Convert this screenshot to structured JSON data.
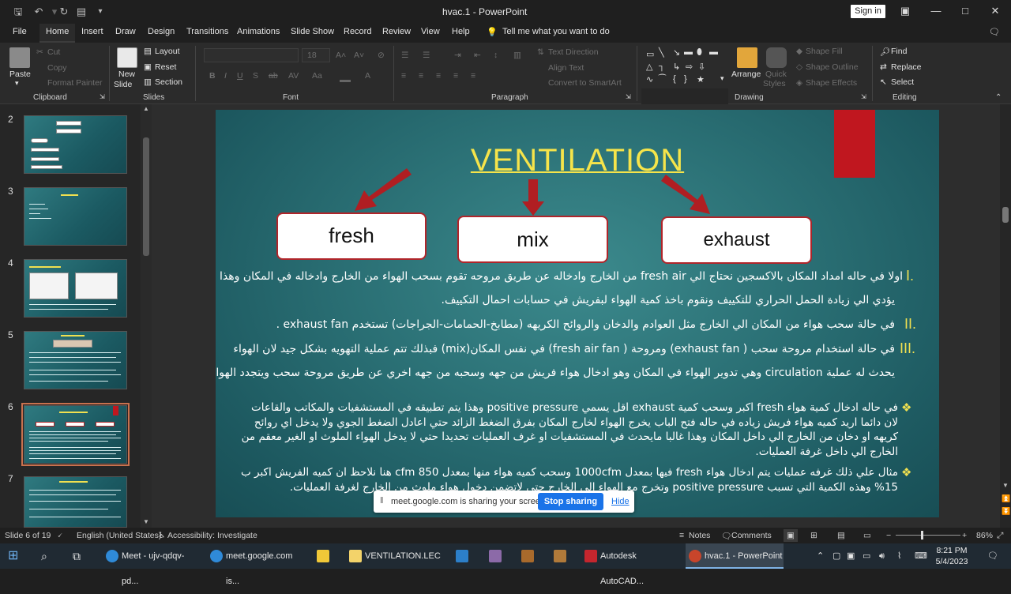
{
  "window": {
    "title": "hvac.1 - PowerPoint",
    "sign_in": "Sign in"
  },
  "tabs": [
    "File",
    "Home",
    "Insert",
    "Draw",
    "Design",
    "Transitions",
    "Animations",
    "Slide Show",
    "Record",
    "Review",
    "View",
    "Help"
  ],
  "active_tab": "Home",
  "tell_me": "Tell me what you want to do",
  "ribbon": {
    "clipboard": {
      "paste": "Paste",
      "cut": "Cut",
      "copy": "Copy",
      "format_painter": "Format Painter",
      "label": "Clipboard"
    },
    "slides": {
      "new_slide_1": "New",
      "new_slide_2": "Slide",
      "layout": "Layout",
      "reset": "Reset",
      "section": "Section",
      "label": "Slides"
    },
    "font": {
      "label": "Font",
      "size": "18"
    },
    "paragraph": {
      "text_direction": "Text Direction",
      "align_text": "Align Text",
      "smartart": "Convert to SmartArt",
      "label": "Paragraph"
    },
    "drawing": {
      "arrange": "Arrange",
      "quick_styles_1": "Quick",
      "quick_styles_2": "Styles",
      "shape_fill": "Shape Fill",
      "shape_outline": "Shape Outline",
      "shape_effects": "Shape Effects",
      "label": "Drawing"
    },
    "editing": {
      "find": "Find",
      "replace": "Replace",
      "select": "Select",
      "label": "Editing"
    }
  },
  "thumbnails": [
    {
      "num": "2",
      "title": "LECTURE (1)",
      "sub": "HVAC"
    },
    {
      "num": "3",
      "title": "HVAC"
    },
    {
      "num": "4",
      "title": "1-Heating process"
    },
    {
      "num": "5",
      "title": "VENTILATION"
    },
    {
      "num": "6",
      "title": "VENTILATION"
    },
    {
      "num": "7",
      "title": "VENTILATION"
    }
  ],
  "slide": {
    "title": "VENTILATION",
    "boxes": [
      "fresh",
      "mix",
      "exhaust"
    ],
    "markers": [
      "I.",
      "II.",
      "III."
    ],
    "line1": "اولا في حاله امداد المكان بالاكسجين نحتاج الي fresh air من الخارج وادخاله عن طريق مروحه تقوم بسحب الهواء من الخارج وادخاله في المكان وهذا",
    "line2": "يؤدي الي زيادة الحمل الحراري للتكييف ونقوم باخذ كمية الهواء لبفريش في حسابات احمال التكييف.",
    "line3": "في حالة سحب هواء من المكان الي الخارج مثل العوادم والدخان والروائح الكريهه (مطابخ-الحمامات-الجراجات) تستخدم exhaust fan .",
    "line4": "في حالة استخدام مروحة سحب ( exhaust fan) ومروحة ( fresh air fan) في نفس المكان(mix) فبذلك تتم عملية التهويه بشكل جيد لان الهواء",
    "line5": "يحدث له عملية circulation وهي تدوير الهواء في المكان وهو ادخال هواء فريش من جهه وسحبه من جهه اخري عن طريق مروحة سحب ويتجدد الهواء.",
    "bullet1": "في حاله ادخال كمية هواء fresh اكبر وسحب كمية exhaust اقل يسمي positive pressure وهذا يتم تطبيقه في المستشفيات والمكاتب والقاعات لان دائما اريد كميه هواء فريش زياده في حاله فتح الباب يخرج الهواء لخارج المكان بفرق الضغط الزائد حتي اعادل الضغط الجوي ولا يدخل اي روائح كريهه او دخان من الخارج الي داخل المكان وهذا غالبا مايحدث في المستشفيات او غرف العمليات تحديدا حتي لا يدخل الهواء الملوث او الغير معقم من الخارج الي داخل غرفة العمليات.",
    "bullet2": "مثال علي ذلك غرفه عمليات يتم ادخال هواء fresh فيها بمعدل 1000cfm وسحب كميه هواء منها بمعدل 850 cfm هنا نلاحظ ان كميه الفريش اكبر ب 15% وهذه الكمية التي تسبب positive pressure وتخرج مع الهواء الى الخارج حتي لاتضمن دخول هواء ملوث من الخارج لغرفة العمليات."
  },
  "sharing": {
    "text": "meet.google.com is sharing your screen.",
    "stop": "Stop sharing",
    "hide": "Hide"
  },
  "status": {
    "slide": "Slide 6 of 19",
    "language": "English (United States)",
    "accessibility": "Accessibility: Investigate",
    "notes": "Notes",
    "comments": "Comments",
    "zoom": "86%"
  },
  "taskbar": {
    "apps": [
      "Meet - ujv-qdqv-pd...",
      "meet.google.com is...",
      "VENTILATION.LEC",
      "Autodesk AutoCAD...",
      "hvac.1 - PowerPoint"
    ],
    "time": "8:21 PM",
    "date": "5/4/2023"
  }
}
